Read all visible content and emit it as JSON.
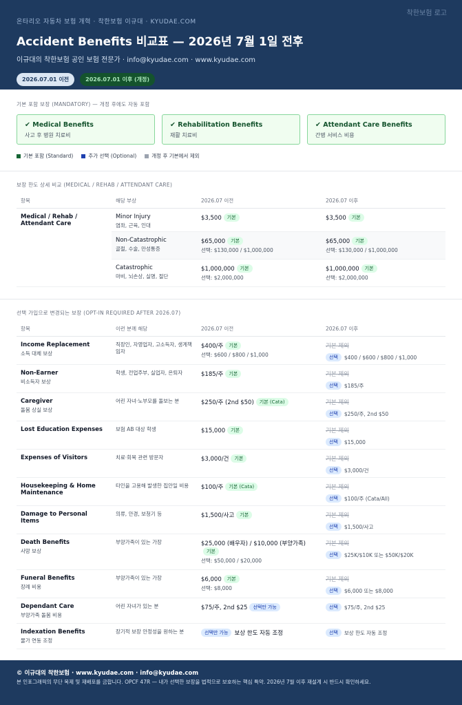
{
  "header": {
    "kicker": "온타리오 자동차 보험 개혁 · 착한보험 이규대 · KYUDAE.COM",
    "title": "Accident Benefits 비교표 — 2026년 7월 1일 전후",
    "subtitle": "이규대의 착한보험 공인 보험 전문가 · info@kyudae.com · www.kyudae.com",
    "pill_before": "2026.07.01 이전",
    "pill_after": "2026.07.01 이후 (개정)",
    "logo": "착한보험 로고"
  },
  "mandatory": {
    "label": "기본 포함 보장 (MANDATORY) — 개정 후에도 자동 포함",
    "cards": [
      {
        "title": "✔ Medical Benefits",
        "sub": "사고 후 병원 치료비"
      },
      {
        "title": "✔ Rehabilitation Benefits",
        "sub": "재활 치료비"
      },
      {
        "title": "✔ Attendant Care Benefits",
        "sub": "간병 서비스 비용"
      }
    ],
    "legend": [
      {
        "label": "기본 포함 (Standard)",
        "color": "#166534"
      },
      {
        "label": "추가 선택 (Optional)",
        "color": "#1e40af"
      },
      {
        "label": "개정 후 기본에서 제외",
        "color": "#9ca3af"
      }
    ]
  },
  "limits": {
    "label": "보장 한도 상세 비교 (MEDICAL / REHAB / ATTENDANT CARE)",
    "headers": [
      "항목",
      "해당 부상",
      "2026.07 이전",
      "2026.07 이후"
    ],
    "item": "Medical / Rehab / Attendant Care",
    "rows": [
      {
        "injury": "Minor Injury",
        "injury_sub": "염좌, 근육, 인대",
        "before": "$3,500",
        "before_tag": "기본",
        "before_detail": "",
        "after": "$3,500",
        "after_tag": "기본",
        "after_detail": ""
      },
      {
        "injury": "Non-Catastrophic",
        "injury_sub": "골절, 수술, 만성통증",
        "before": "$65,000",
        "before_tag": "기본",
        "before_detail": "선택: $130,000 / $1,000,000",
        "after": "$65,000",
        "after_tag": "기본",
        "after_detail": "선택: $130,000 / $1,000,000"
      },
      {
        "injury": "Catastrophic",
        "injury_sub": "마비, 뇌손상, 실명, 절단",
        "before": "$1,000,000",
        "before_tag": "기본",
        "before_detail": "선택: $2,000,000",
        "after": "$1,000,000",
        "after_tag": "기본",
        "after_detail": "선택: $2,000,000"
      }
    ]
  },
  "optin": {
    "label": "선택 가입으로 변경되는 보장 (OPT-IN REQUIRED AFTER 2026.07)",
    "headers": [
      "항목",
      "이런 분께 해당",
      "2026.07 이전",
      "2026.07 이후"
    ],
    "removed_label": "기본 제외",
    "select_tag": "선택",
    "rows": [
      {
        "item": "Income Replacement",
        "item_sub": "소득 대체 보상",
        "who": "직장인, 자영업자, 고소득자, 생계책임자",
        "before": "$400/주",
        "before_tag": "기본",
        "before_detail": "선택: $600 / $800 / $1,000",
        "after": "$400 / $600 / $800 / $1,000"
      },
      {
        "item": "Non-Earner",
        "item_sub": "비소득자 보상",
        "who": "학생, 전업주부, 실업자, 은퇴자",
        "before": "$185/주",
        "before_tag": "기본",
        "before_detail": "",
        "after": "$185/주"
      },
      {
        "item": "Caregiver",
        "item_sub": "돌봄 상실 보상",
        "who": "어린 자녀·노부모를 돌보는 분",
        "before": "$250/주 (2nd $50)",
        "before_tag": "기본 (Cata)",
        "before_detail": "",
        "after": "$250/주, 2nd $50"
      },
      {
        "item": "Lost Education Expenses",
        "item_sub": "",
        "who": "보험 AB 대상 학생",
        "before": "$15,000",
        "before_tag": "기본",
        "before_detail": "",
        "after": "$15,000"
      },
      {
        "item": "Expenses of Visitors",
        "item_sub": "",
        "who": "치료·회복 관련 방문자",
        "before": "$3,000/건",
        "before_tag": "기본",
        "before_detail": "",
        "after": "$3,000/건"
      },
      {
        "item": "Housekeeping & Home Maintenance",
        "item_sub": "",
        "who": "타인을 고용해 발생한 집안일 비용",
        "before": "$100/주",
        "before_tag": "기본 (Cata)",
        "before_detail": "",
        "after": "$100/주 (Cata/All)"
      },
      {
        "item": "Damage to Personal Items",
        "item_sub": "",
        "who": "의류, 안경, 보청기 등",
        "before": "$1,500/사고",
        "before_tag": "기본",
        "before_detail": "",
        "after": "$1,500/사고"
      },
      {
        "item": "Death Benefits",
        "item_sub": "사망 보상",
        "who": "부양가족이 있는 가장",
        "before": "$25,000 (배우자) / $10,000 (부양가족)",
        "before_tag": "기본",
        "before_detail": "선택: $50,000 / $20,000",
        "after": "$25K/$10K 또는 $50K/$20K"
      },
      {
        "item": "Funeral Benefits",
        "item_sub": "장례 비용",
        "who": "부양가족이 있는 가장",
        "before": "$6,000",
        "before_tag": "기본",
        "before_detail": "선택: $8,000",
        "after": "$6,000 또는 $8,000"
      },
      {
        "item": "Dependant Care",
        "item_sub": "부양가족 돌봄 비용",
        "who": "어린 자녀가 있는 분",
        "before": "$75/주, 2nd $25",
        "before_tag_b": "선택만 가능",
        "before_detail": "",
        "after": "$75/주, 2nd $25",
        "after_no_strike": true
      },
      {
        "item": "Indexation Benefits",
        "item_sub": "물가 연동 조정",
        "who": "장기적 보장 안정성을 원하는 분",
        "before": "보상 한도 자동 조정",
        "before_tag_b_lead": "선택만 가능",
        "before_detail": "",
        "after": "보상 한도 자동 조정",
        "after_no_strike": true
      }
    ]
  },
  "footer": {
    "line1": "© 이규대의 착한보험 · www.kyudae.com · info@kyudae.com",
    "line2": "본 인포그래픽의 무단 복제 및 재배포를 금합니다. OPCF 47R — 내가 선택한 보장을 법적으로 보호하는 핵심 특약. 2026년 7월 이후 재설계 시 반드시 확인하세요."
  }
}
